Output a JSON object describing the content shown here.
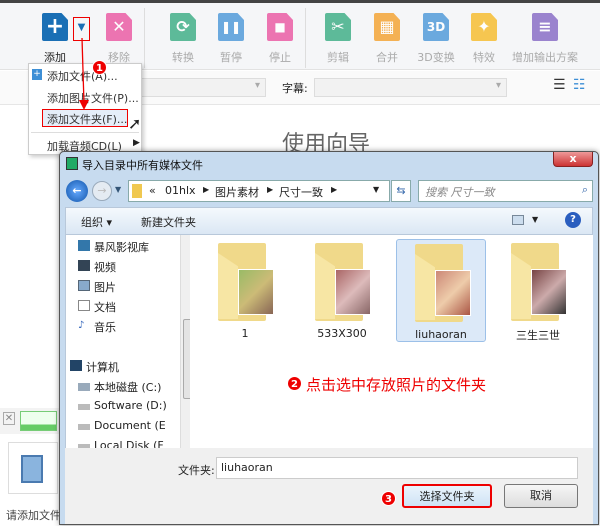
{
  "toolbar": {
    "items": [
      {
        "label": "添加",
        "color": "#1a6fb5",
        "glyph": "+"
      },
      {
        "label": "移除",
        "color": "#e8489a",
        "glyph": "✕"
      },
      {
        "label": "转换",
        "color": "#2aa67a",
        "glyph": "⟳"
      },
      {
        "label": "暂停",
        "color": "#3d8fd6",
        "glyph": "❚❚"
      },
      {
        "label": "停止",
        "color": "#e8489a",
        "glyph": "■"
      },
      {
        "label": "剪辑",
        "color": "#2aa67a",
        "glyph": "✂"
      },
      {
        "label": "合并",
        "color": "#f39a1e",
        "glyph": "▦"
      },
      {
        "label": "3D变换",
        "color": "#3d8fd6",
        "glyph": "3D"
      },
      {
        "label": "特效",
        "color": "#f6b619",
        "glyph": "✦"
      },
      {
        "label": "增加输出方案",
        "color": "#7b5cc0",
        "glyph": "≡"
      }
    ]
  },
  "row2": {
    "subtitle_label": "字幕:"
  },
  "guide": "使用向导",
  "menu": {
    "items": [
      "添加文件(A)...",
      "添加图片文件(P)...",
      "添加文件夹(F)...",
      "加载音频CD(L)"
    ]
  },
  "dialog": {
    "title": "导入目录中所有媒体文件",
    "close": "x",
    "breadcrumb": [
      "«",
      "01hlx",
      "图片素材",
      "尺寸一致"
    ],
    "search_placeholder": "搜索 尺寸一致",
    "organize": "组织 ▾",
    "new_folder": "新建文件夹",
    "nav": [
      {
        "label": "暴风影视库",
        "icon": "library"
      },
      {
        "label": "视频",
        "icon": "video"
      },
      {
        "label": "图片",
        "icon": "picture"
      },
      {
        "label": "文档",
        "icon": "document"
      },
      {
        "label": "音乐",
        "icon": "music"
      },
      {
        "label": "计算机",
        "icon": "computer"
      },
      {
        "label": "本地磁盘 (C:)",
        "icon": "drive"
      },
      {
        "label": "Software (D:)",
        "icon": "drive"
      },
      {
        "label": "Document (E",
        "icon": "drive"
      },
      {
        "label": "Local Disk (F",
        "icon": "drive"
      }
    ],
    "folders": [
      "1",
      "533X300",
      "liuhaoran",
      "三生三世"
    ],
    "selected_folder": "liuhaoran",
    "folder_label": "文件夹:",
    "folder_value": "liuhaoran",
    "select_button": "选择文件夹",
    "cancel_button": "取消"
  },
  "annotations": {
    "step1": "1",
    "step2": "2",
    "step2_text": "点击选中存放照片的文件夹",
    "step3": "3",
    "color": "#e00000"
  },
  "left_panel": {
    "hint": "请添加文件"
  }
}
